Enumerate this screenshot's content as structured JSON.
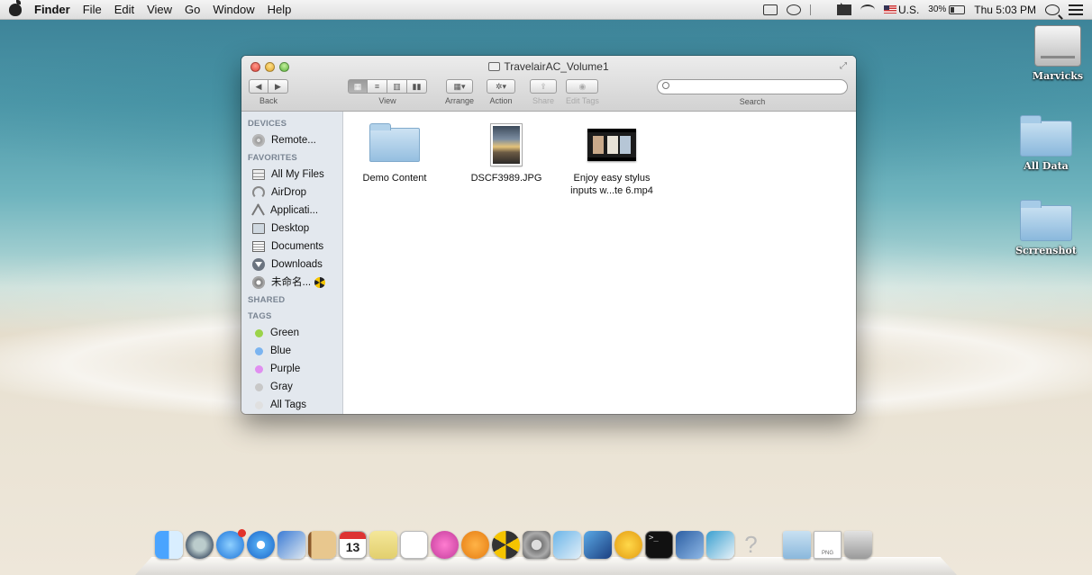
{
  "menubar": {
    "app_name": "Finder",
    "menus": [
      "File",
      "Edit",
      "View",
      "Go",
      "Window",
      "Help"
    ],
    "input_source": "U.S.",
    "battery_percent": "30%",
    "battery_level": 0.3,
    "clock": "Thu 5:03 PM"
  },
  "desktop_icons": [
    {
      "label": "Marvicks",
      "icon": "hard-drive-icon"
    },
    {
      "label": "All Data",
      "icon": "folder-icon"
    },
    {
      "label": "Scrrenshot",
      "icon": "folder-icon"
    }
  ],
  "window": {
    "title": "TravelairAC_Volume1",
    "toolbar": {
      "back": "Back",
      "view": "View",
      "arrange": "Arrange",
      "action": "Action",
      "share": "Share",
      "edit_tags": "Edit Tags",
      "search_label": "Search"
    },
    "sidebar": {
      "devices_header": "DEVICES",
      "devices": [
        {
          "label": "Remote...",
          "icon": "disc-icon"
        }
      ],
      "favorites_header": "FAVORITES",
      "favorites": [
        {
          "label": "All My Files",
          "icon": "all-files-icon"
        },
        {
          "label": "AirDrop",
          "icon": "airdrop-icon"
        },
        {
          "label": "Applicati...",
          "icon": "applications-icon"
        },
        {
          "label": "Desktop",
          "icon": "desktop-icon"
        },
        {
          "label": "Documents",
          "icon": "documents-icon"
        },
        {
          "label": "Downloads",
          "icon": "downloads-icon"
        },
        {
          "label": "未命名...",
          "icon": "external-drive-icon"
        }
      ],
      "shared_header": "SHARED",
      "tags_header": "TAGS",
      "tags": [
        {
          "label": "Green",
          "color": "#9bd34a"
        },
        {
          "label": "Blue",
          "color": "#7bb4f0"
        },
        {
          "label": "Purple",
          "color": "#e08ff0"
        },
        {
          "label": "Gray",
          "color": "#c8c8c8"
        },
        {
          "label": "All Tags",
          "color": "#e0e0e0"
        }
      ]
    },
    "files": [
      {
        "name": "Demo Content",
        "icon": "folder-icon"
      },
      {
        "name": "DSCF3989.JPG",
        "icon": "photo-thumbnail"
      },
      {
        "name": "Enjoy easy stylus inputs w...te 6.mp4",
        "icon": "video-thumbnail"
      }
    ]
  },
  "dock": {
    "items": [
      "finder",
      "launchpad",
      "app-store",
      "safari",
      "preview",
      "contacts",
      "calendar",
      "notes",
      "reminders",
      "itunes",
      "ibooks",
      "radiation-app",
      "system-preferences",
      "photo-app",
      "xcode",
      "w-app",
      "terminal",
      "utility-app",
      "screenshot-app",
      "unknown-app",
      "folder-stack",
      "png-file",
      "trash"
    ],
    "calendar_day": "13",
    "app_store_badge": "1"
  }
}
